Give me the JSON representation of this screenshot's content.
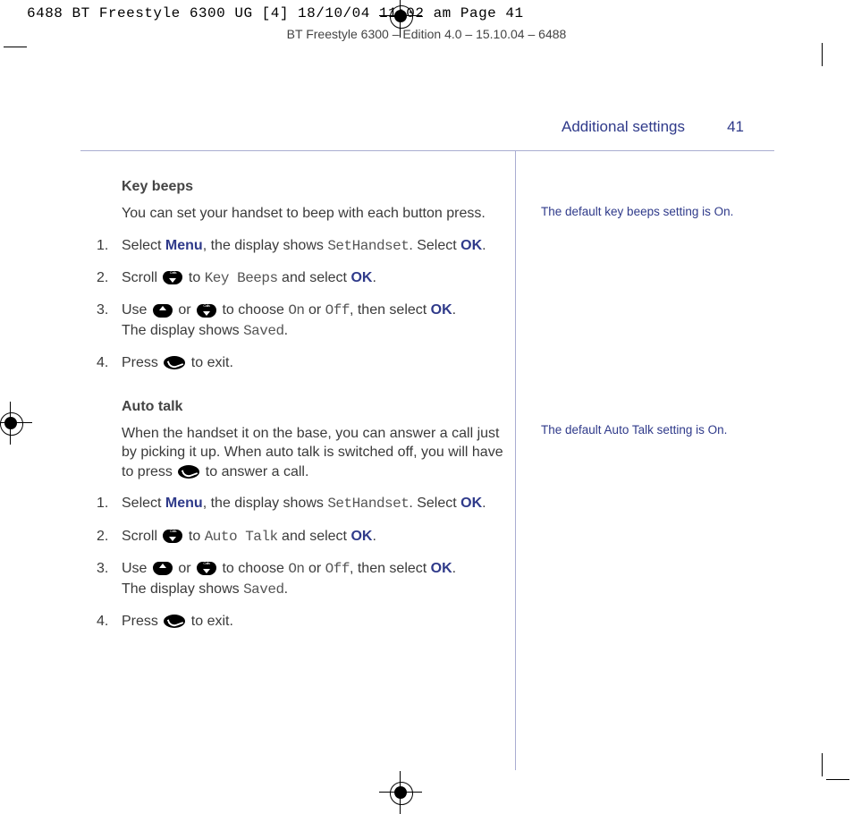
{
  "slug": "6488 BT Freestyle 6300 UG [4]  18/10/04  11:02 am  Page 41",
  "edition": "BT Freestyle 6300 – Edition 4.0 – 15.10.04 – 6488",
  "header": {
    "title": "Additional settings",
    "page": "41"
  },
  "key_beeps": {
    "heading": "Key beeps",
    "intro": "You can set your handset to beep with each button press.",
    "steps": {
      "s1a": "Select ",
      "s1b": "Menu",
      "s1c": ", the display shows ",
      "s1d": "SetHandset",
      "s1e": ". Select ",
      "s1f": "OK",
      "s1g": ".",
      "s2a": "Scroll ",
      "s2b": " to ",
      "s2c": "Key Beeps",
      "s2d": " and select ",
      "s2e": "OK",
      "s2f": ".",
      "s3a": "Use ",
      "s3b": " or ",
      "s3c": " to choose ",
      "s3d": "On",
      "s3e": " or ",
      "s3f": "Off",
      "s3g": ", then select ",
      "s3h": "OK",
      "s3i": ".",
      "s3j": "The display shows ",
      "s3k": "Saved",
      "s3l": ".",
      "s4a": "Press ",
      "s4b": " to exit."
    }
  },
  "auto_talk": {
    "heading": "Auto talk",
    "intro": "When the handset it on the base, you can answer a call just by picking it up. When auto talk is switched off, you will have to press      to answer a call.",
    "intro_a": "When the handset it on the base, you can answer a call just by picking it up. When auto talk is switched off, you will have to press ",
    "intro_b": " to answer a call.",
    "steps": {
      "s1a": "Select ",
      "s1b": "Menu",
      "s1c": ", the display shows ",
      "s1d": "SetHandset",
      "s1e": ". Select ",
      "s1f": "OK",
      "s1g": ".",
      "s2a": "Scroll ",
      "s2b": " to ",
      "s2c": "Auto Talk",
      "s2d": " and select ",
      "s2e": "OK",
      "s2f": ".",
      "s3a": "Use ",
      "s3b": " or ",
      "s3c": " to choose ",
      "s3d": "On",
      "s3e": " or ",
      "s3f": "Off",
      "s3g": ", then select ",
      "s3h": "OK",
      "s3i": ".",
      "s3j": "The display shows ",
      "s3k": "Saved",
      "s3l": ".",
      "s4a": "Press ",
      "s4b": " to exit."
    }
  },
  "notes": {
    "n1": "The default key beeps setting is On.",
    "n2": "The default Auto Talk setting is On."
  }
}
